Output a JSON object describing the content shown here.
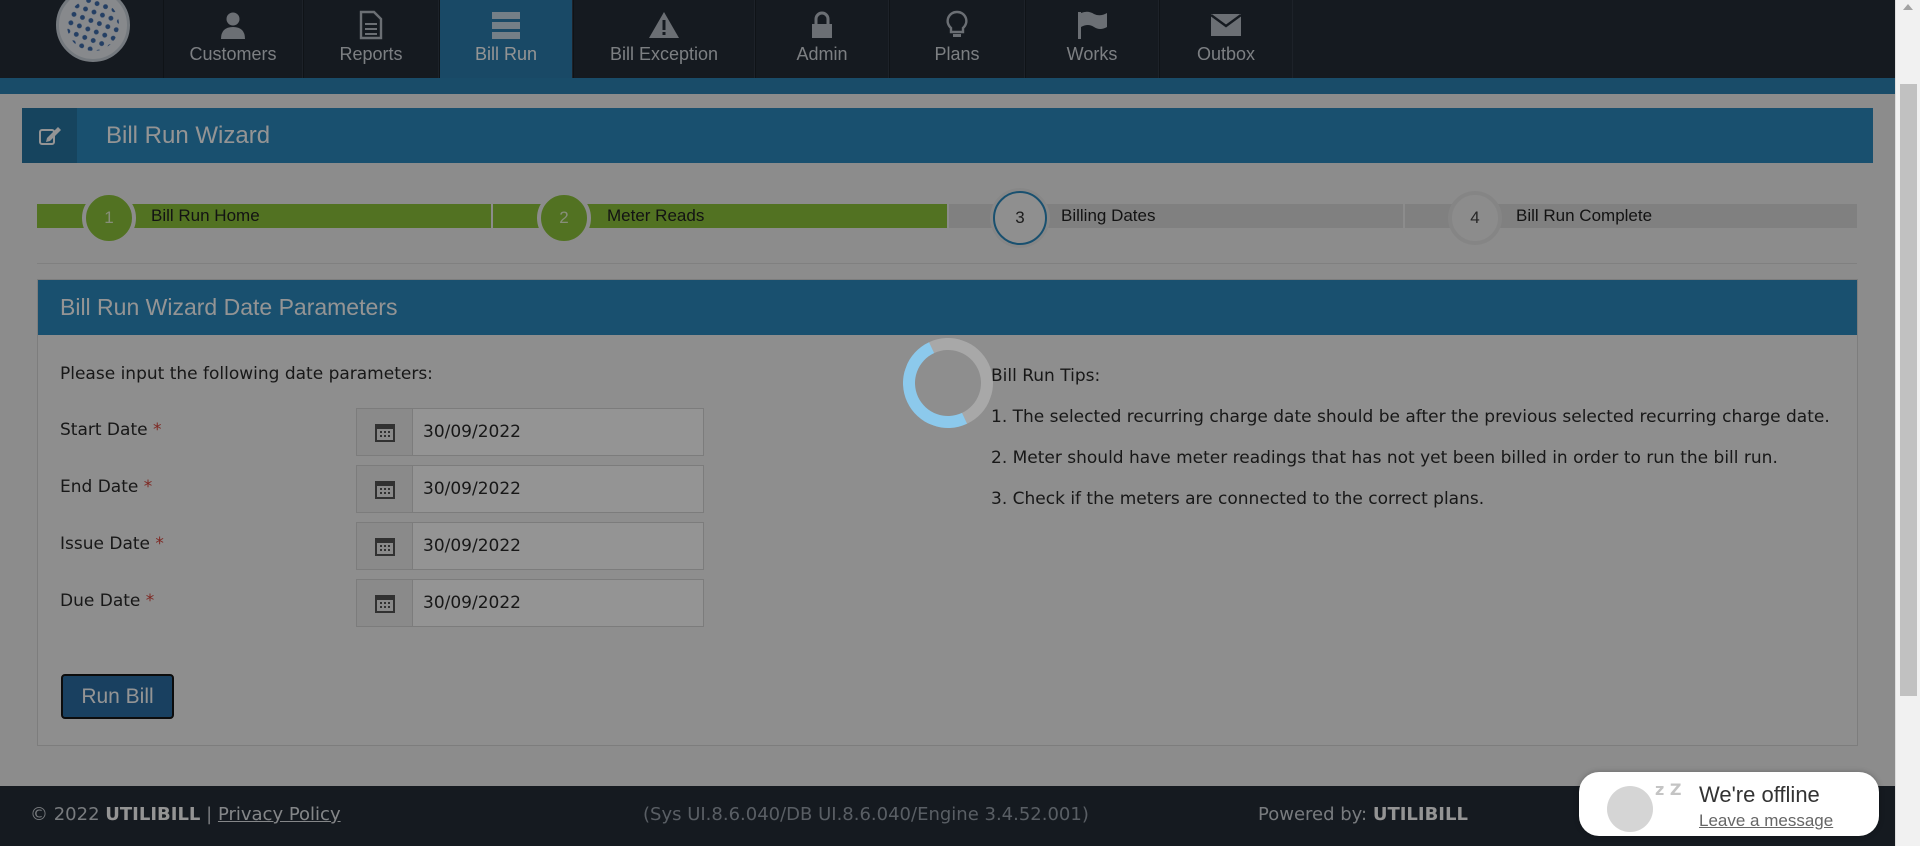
{
  "nav": {
    "items": [
      {
        "label": "Customers",
        "icon": "user-icon"
      },
      {
        "label": "Reports",
        "icon": "file-icon"
      },
      {
        "label": "Bill Run",
        "icon": "server-icon",
        "active": true
      },
      {
        "label": "Bill Exception",
        "icon": "warning-icon"
      },
      {
        "label": "Admin",
        "icon": "lock-icon"
      },
      {
        "label": "Plans",
        "icon": "lightbulb-icon"
      },
      {
        "label": "Works",
        "icon": "flag-icon"
      },
      {
        "label": "Outbox",
        "icon": "envelope-icon"
      }
    ]
  },
  "wizard": {
    "title": "Bill Run Wizard",
    "steps": [
      {
        "number": "1",
        "label": "Bill Run Home",
        "state": "done"
      },
      {
        "number": "2",
        "label": "Meter Reads",
        "state": "done"
      },
      {
        "number": "3",
        "label": "Billing Dates",
        "state": "current"
      },
      {
        "number": "4",
        "label": "Bill Run Complete",
        "state": "todo"
      }
    ]
  },
  "params": {
    "title": "Bill Run Wizard Date Parameters",
    "intro": "Please input the following date parameters:",
    "required_mark": "*",
    "fields": [
      {
        "label": "Start Date",
        "value": "30/09/2022"
      },
      {
        "label": "End Date",
        "value": "30/09/2022"
      },
      {
        "label": "Issue Date",
        "value": "30/09/2022"
      },
      {
        "label": "Due Date",
        "value": "30/09/2022"
      }
    ],
    "run_button": "Run Bill"
  },
  "tips": {
    "heading": "Bill Run Tips:",
    "items": [
      "1. The selected recurring charge date should be after the previous selected recurring charge date.",
      "2. Meter should have meter readings that has not yet been billed in order to run the bill run.",
      "3. Check if the meters are connected to the correct plans."
    ]
  },
  "footer": {
    "copyright": "© 2022",
    "brand": "UTILIBILL",
    "separator": "|",
    "privacy": "Privacy Policy",
    "version": "(Sys UI.8.6.040/DB UI.8.6.040/Engine 3.4.52.001)",
    "powered_label": "Powered by:",
    "powered_brand": "UTILIBILL"
  },
  "chat": {
    "status": "We're offline",
    "action": "Leave a message",
    "zz": "z Z"
  },
  "colors": {
    "accent": "#2b8bc0",
    "nav_bg": "#252d38",
    "step_done": "#8dc43b",
    "required": "#d9453c"
  }
}
